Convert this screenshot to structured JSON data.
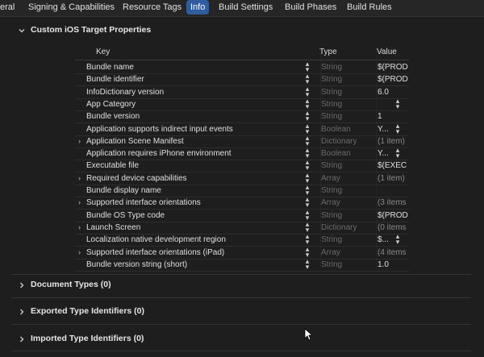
{
  "tabs": [
    {
      "label": "eral"
    },
    {
      "label": "Signing & Capabilities"
    },
    {
      "label": "Resource Tags"
    },
    {
      "label": "Info",
      "selected": true
    },
    {
      "label": "Build Settings"
    },
    {
      "label": "Build Phases"
    },
    {
      "label": "Build Rules"
    }
  ],
  "sections": {
    "custom": {
      "title": "Custom iOS Target Properties",
      "expanded": true
    },
    "document_types": {
      "title": "Document Types (0)"
    },
    "exported": {
      "title": "Exported Type Identifiers (0)"
    },
    "imported": {
      "title": "Imported Type Identifiers (0)"
    }
  },
  "table": {
    "headers": {
      "key": "Key",
      "type": "Type",
      "value": "Value"
    },
    "rows": [
      {
        "key": "Bundle name",
        "type": "String",
        "value": "$(PROD"
      },
      {
        "key": "Bundle identifier",
        "type": "String",
        "value": "$(PROD"
      },
      {
        "key": "InfoDictionary version",
        "type": "String",
        "value": "6.0"
      },
      {
        "key": "App Category",
        "type": "String",
        "value": ""
      },
      {
        "key": "Bundle version",
        "type": "String",
        "value": "1"
      },
      {
        "key": "Application supports indirect input events",
        "type": "Boolean",
        "value": "Y..."
      },
      {
        "key": "Application Scene Manifest",
        "type": "Dictionary",
        "value": "(1 item)"
      },
      {
        "key": "Application requires iPhone environment",
        "type": "Boolean",
        "value": "Y..."
      },
      {
        "key": "Executable file",
        "type": "String",
        "value": "$(EXEC"
      },
      {
        "key": "Required device capabilities",
        "type": "Array",
        "value": "(1 item)"
      },
      {
        "key": "Bundle display name",
        "type": "String",
        "value": ""
      },
      {
        "key": "Supported interface orientations",
        "type": "Array",
        "value": "(3 items"
      },
      {
        "key": "Bundle OS Type code",
        "type": "String",
        "value": "$(PROD"
      },
      {
        "key": "Launch Screen",
        "type": "Dictionary",
        "value": "(0 items"
      },
      {
        "key": "Localization native development region",
        "type": "String",
        "value": "$..."
      },
      {
        "key": "Supported interface orientations (iPad)",
        "type": "Array",
        "value": "(4 items"
      },
      {
        "key": "Bundle version string (short)",
        "type": "String",
        "value": "1.0"
      }
    ]
  },
  "icons": {
    "expanded_chevron": "chevron-down-icon",
    "collapsed_chevron": "chevron-right-icon",
    "stepper": "up-down-stepper-icon",
    "cursor": "mouse-pointer-icon"
  },
  "colors": {
    "accent": "#2f5da0",
    "background": "#1e1e1e"
  }
}
